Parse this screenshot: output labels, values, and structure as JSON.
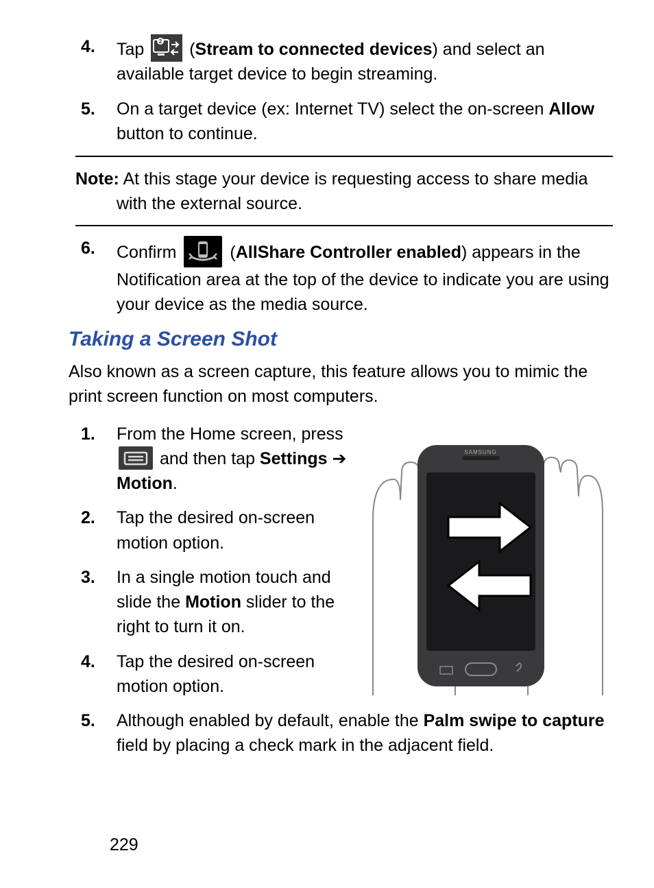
{
  "stepsA": [
    {
      "num": "4.",
      "pre": "Tap ",
      "iconLabel": "Stream to connected devices",
      "post": ") and select an available target device to begin streaming."
    },
    {
      "num": "5.",
      "pre": "On a target device (ex: Internet TV) select the on-screen ",
      "bold": "Allow",
      "post": " button to continue."
    }
  ],
  "note": {
    "label": "Note:",
    "text": " At this stage your device is requesting access to share media with the external source."
  },
  "step6": {
    "num": "6.",
    "pre": "Confirm ",
    "iconLabel": "AllShare Controller enabled",
    "post": ") appears in the Notification area at the top of the device to indicate you are using your device as the media source."
  },
  "heading": "Taking a Screen Shot",
  "intro": "Also known as a screen capture, this feature allows you to mimic the print screen function on most computers.",
  "stepsB": {
    "s1": {
      "num": "1.",
      "frag1": "From the Home screen, press ",
      "frag2": " and then tap ",
      "settings": "Settings",
      "arrow": " ➔ ",
      "motion": "Motion",
      "period": "."
    },
    "s2": {
      "num": "2.",
      "text": "Tap the desired on-screen motion option."
    },
    "s3": {
      "num": "3.",
      "pre": "In a single motion touch and slide the ",
      "bold": "Motion",
      "post": " slider to the right to turn it on."
    },
    "s4": {
      "num": "4.",
      "text": "Tap the desired on-screen motion option."
    },
    "s5": {
      "num": "5.",
      "pre": "Although enabled by default, enable the ",
      "bold": "Palm swipe to capture",
      "post": " field by placing a check mark in the adjacent field."
    }
  },
  "figure": {
    "phoneBrand": "SAMSUNG"
  },
  "pageNumber": "229"
}
